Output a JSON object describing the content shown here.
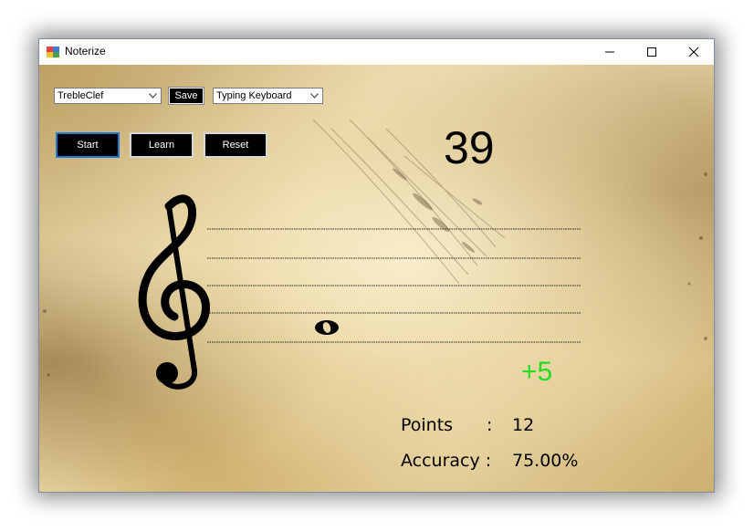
{
  "window": {
    "title": "Noterize",
    "controls": {
      "minimize": "minimize-icon",
      "maximize": "maximize-icon",
      "close": "close-icon"
    }
  },
  "toolbar": {
    "clef_select": {
      "value": "TrebleClef"
    },
    "save_label": "Save",
    "input_select": {
      "value": "Typing Keyboard"
    }
  },
  "actions": {
    "start_label": "Start",
    "learn_label": "Learn",
    "reset_label": "Reset"
  },
  "game": {
    "timer": "39",
    "bonus": "+5",
    "clef_icon": "treble-clef-icon",
    "note_icon": "whole-note-icon"
  },
  "stats": {
    "points_label": "Points",
    "points_sep": ":",
    "points_value": "12",
    "accuracy_label": "Accuracy :",
    "accuracy_value": "75.00%"
  },
  "colors": {
    "bonus": "#22dd22",
    "focus_border": "#1e78d6",
    "button_bg": "#000000"
  }
}
